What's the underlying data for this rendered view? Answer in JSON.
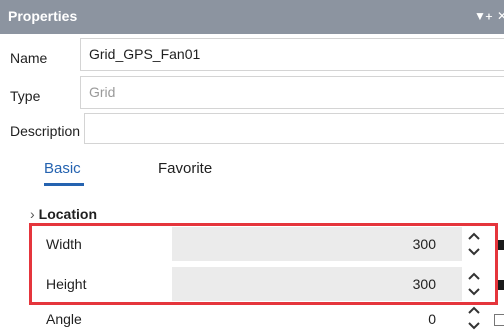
{
  "panel": {
    "title": "Properties",
    "icons": [
      "dropdown-icon",
      "pin-icon",
      "close-icon"
    ]
  },
  "fields": {
    "name": {
      "label": "Name",
      "value": "Grid_GPS_Fan01"
    },
    "type": {
      "label": "Type",
      "value": "Grid"
    },
    "description": {
      "label": "Description",
      "value": ""
    }
  },
  "tabs": {
    "basic": "Basic",
    "favorite": "Favorite",
    "active": "Basic"
  },
  "section": {
    "title": "Location"
  },
  "properties": [
    {
      "label": "Width",
      "value": "300"
    },
    {
      "label": "Height",
      "value": "300"
    },
    {
      "label": "Angle",
      "value": "0"
    }
  ],
  "colors": {
    "titlebar": "#8c94a0",
    "accent": "#2563b0",
    "highlight": "#e5353c"
  }
}
